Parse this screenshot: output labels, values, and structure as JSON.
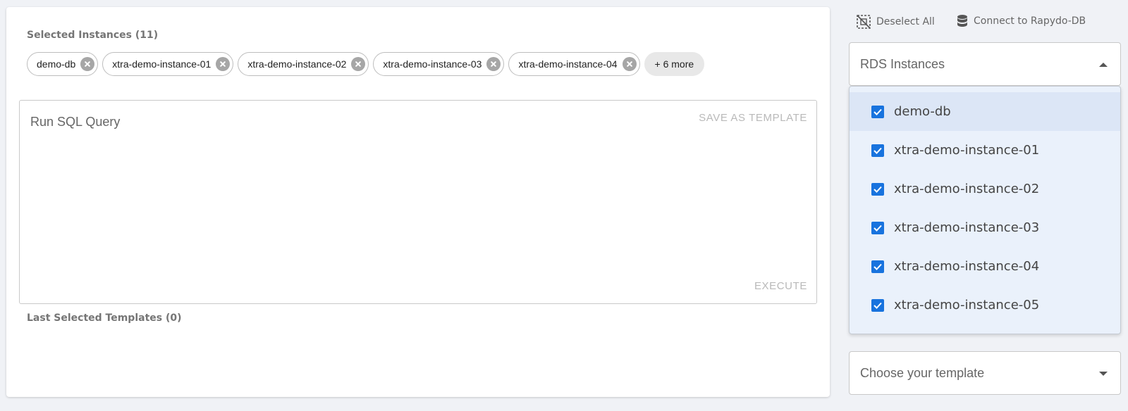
{
  "selected": {
    "title": "Selected Instances (11)",
    "chips": [
      "demo-db",
      "xtra-demo-instance-01",
      "xtra-demo-instance-02",
      "xtra-demo-instance-03",
      "xtra-demo-instance-04"
    ],
    "more_label": "+ 6 more"
  },
  "query": {
    "placeholder": "Run SQL Query",
    "save_template_label": "SAVE AS TEMPLATE",
    "execute_label": "EXECUTE"
  },
  "templates": {
    "last_title": "Last Selected Templates (0)"
  },
  "toolbar": {
    "deselect_label": "Deselect All",
    "connect_label": "Connect to Rapydo-DB"
  },
  "rds_select": {
    "label": "RDS Instances",
    "options": [
      "demo-db",
      "xtra-demo-instance-01",
      "xtra-demo-instance-02",
      "xtra-demo-instance-03",
      "xtra-demo-instance-04",
      "xtra-demo-instance-05"
    ]
  },
  "template_select": {
    "placeholder": "Choose your template"
  },
  "colors": {
    "accent": "#1873de",
    "dropdown_bg": "#eaf1fb"
  }
}
